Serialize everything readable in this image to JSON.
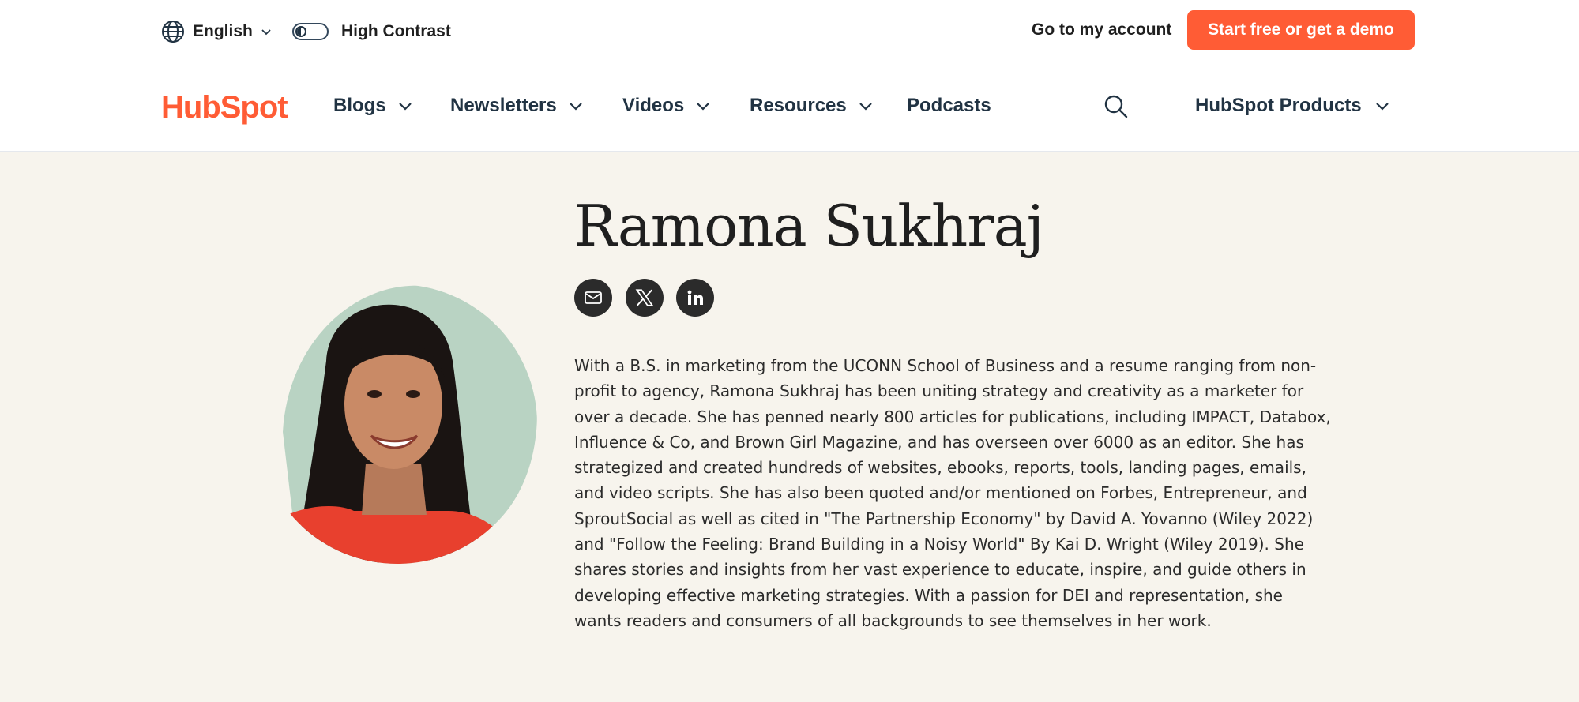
{
  "utility_bar": {
    "language": {
      "label": "English",
      "icon": "globe-icon"
    },
    "high_contrast": {
      "label": "High Contrast",
      "enabled": false
    },
    "account_link": "Go to my account",
    "cta_button": "Start free or get a demo"
  },
  "nav": {
    "logo": "HubSpot",
    "items": [
      {
        "label": "Blogs",
        "has_dropdown": true
      },
      {
        "label": "Newsletters",
        "has_dropdown": true
      },
      {
        "label": "Videos",
        "has_dropdown": true
      },
      {
        "label": "Resources",
        "has_dropdown": true
      },
      {
        "label": "Podcasts",
        "has_dropdown": false
      }
    ],
    "products_menu": "HubSpot Products"
  },
  "author": {
    "name": "Ramona Sukhraj",
    "social_links": [
      "email-icon",
      "x-icon",
      "linkedin-icon"
    ],
    "bio": "With a B.S. in marketing from the UCONN School of Business and a resume ranging from non-profit to agency, Ramona Sukhraj has been uniting strategy and creativity as a marketer for over a decade. She has penned nearly 800 articles for publications, including IMPACT, Databox, Influence & Co, and Brown Girl Magazine, and has overseen over 6000 as an editor. She has strategized and created hundreds of websites, ebooks, reports, tools, landing pages, emails, and video scripts. She has also been quoted and/or mentioned on Forbes, Entrepreneur, and SproutSocial as well as cited in \"The Partnership Economy\" by David A. Yovanno (Wiley 2022) and \"Follow the Feeling: Brand Building in a Noisy World\" By Kai D. Wright (Wiley 2019). She shares stories and insights from her vast experience to educate, inspire, and guide others in developing effective marketing strategies. With a passion for DEI and representation, she wants readers and consumers of all backgrounds to see themselves in her work."
  },
  "colors": {
    "brand_orange": "#ff5c35",
    "navy": "#213343",
    "cream_background": "#f7f4ed",
    "portrait_backdrop": "#b9d3c3"
  }
}
